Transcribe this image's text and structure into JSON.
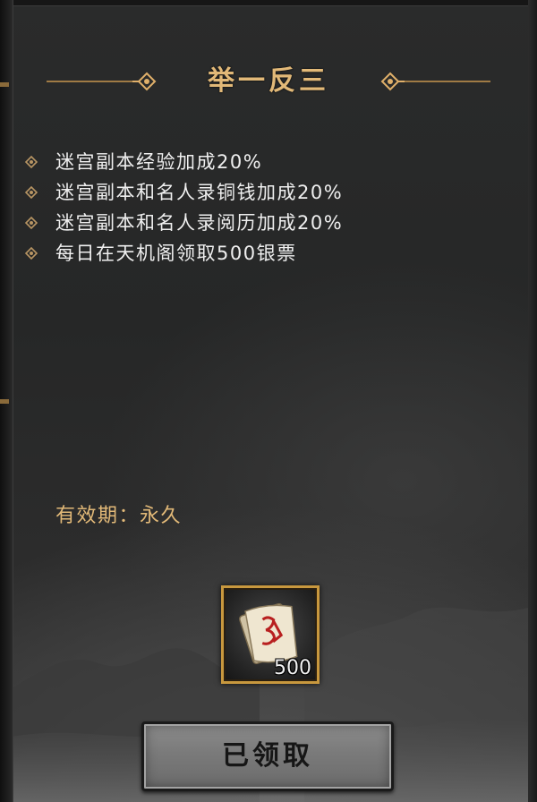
{
  "title": "举一反三",
  "benefits": [
    "迷宫副本经验加成20%",
    "迷宫副本和名人录铜钱加成20%",
    "迷宫副本和名人录阅历加成20%",
    "每日在天机阁领取500银票"
  ],
  "validity": "有效期：永久",
  "reward": {
    "icon": "silver-note-icon",
    "count": "500"
  },
  "claim_button_label": "已领取",
  "colors": {
    "gold": "#e2b978",
    "text": "#efefef",
    "slot_border": "#c8983e",
    "button": "#7a7a7a"
  }
}
